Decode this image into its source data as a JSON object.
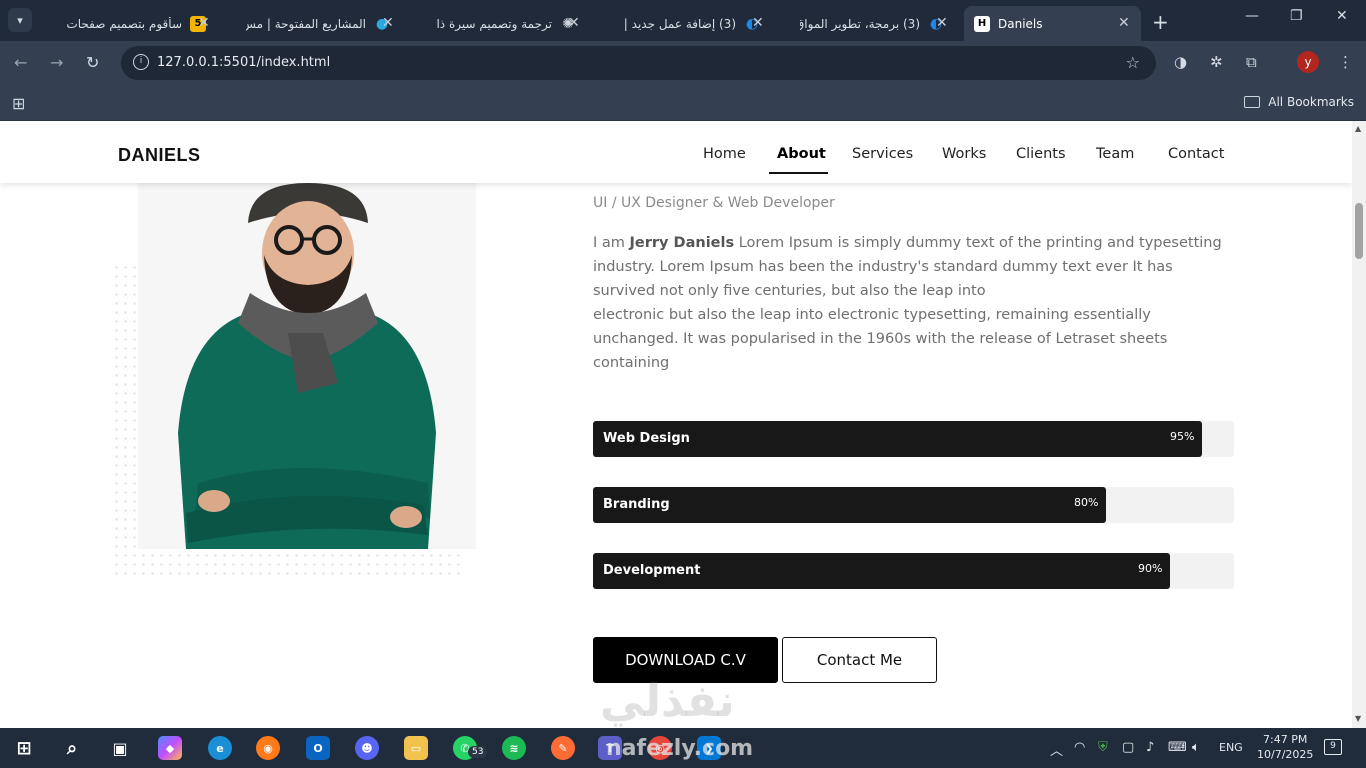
{
  "browser": {
    "tabs": [
      {
        "title": "سأقوم بتصميم صفحات",
        "favicon": "5",
        "favicon_color": "#f4b400"
      },
      {
        "title": "المشاريع المفتوحة | مس",
        "favicon": "●",
        "favicon_color": "#2aa7e0"
      },
      {
        "title": "ترجمة وتصميم سيرة ذا",
        "favicon": "✺",
        "favicon_color": "#cfd5de"
      },
      {
        "title": "(3) إضافة عمل جديد |",
        "favicon": "◐",
        "favicon_color": "#1e88e5"
      },
      {
        "title": "(3) برمجة، تطوير المواق",
        "favicon": "◐",
        "favicon_color": "#1e88e5"
      },
      {
        "title": "Daniels",
        "favicon": "H",
        "favicon_color": "#ffffff"
      }
    ],
    "url": "127.0.0.1:5501/index.html",
    "avatar_letter": "y",
    "all_bookmarks": "All Bookmarks"
  },
  "site": {
    "brand": "DANIELS",
    "nav": [
      "Home",
      "About",
      "Services",
      "Works",
      "Clients",
      "Team",
      "Contact"
    ],
    "active_nav": "About",
    "subtitle": "UI / UX Designer & Web Developer",
    "bio": {
      "prefix": "I am ",
      "name": "Jerry Daniels",
      "line1_rest": " Lorem Ipsum is simply dummy text of the printing and typesetting industry. Lorem Ipsum has been the industry's standard dummy text ever It has survived not only five centuries, but also the leap into",
      "line2": "electronic but also the leap into electronic typesetting, remaining essentially unchanged. It was popularised in the 1960s with the release of Letraset sheets containing"
    },
    "skills": [
      {
        "name": "Web Design",
        "percent_label": "95%",
        "value": 95
      },
      {
        "name": "Branding",
        "percent_label": "80%",
        "value": 80
      },
      {
        "name": "Development",
        "percent_label": "90%",
        "value": 90
      }
    ],
    "buttons": {
      "download": "DOWNLOAD C.V",
      "contact": "Contact Me"
    },
    "watermark_ar": "نفذلي",
    "watermark_en": "nafezly.com"
  },
  "taskbar": {
    "whatsapp_badge": "53",
    "language": "ENG",
    "time": "7:47 PM",
    "date": "10/7/2025",
    "notifications": "9"
  },
  "colors": {
    "accent": "#181818",
    "track": "#f2f2f2",
    "chrome": "#343f52"
  }
}
